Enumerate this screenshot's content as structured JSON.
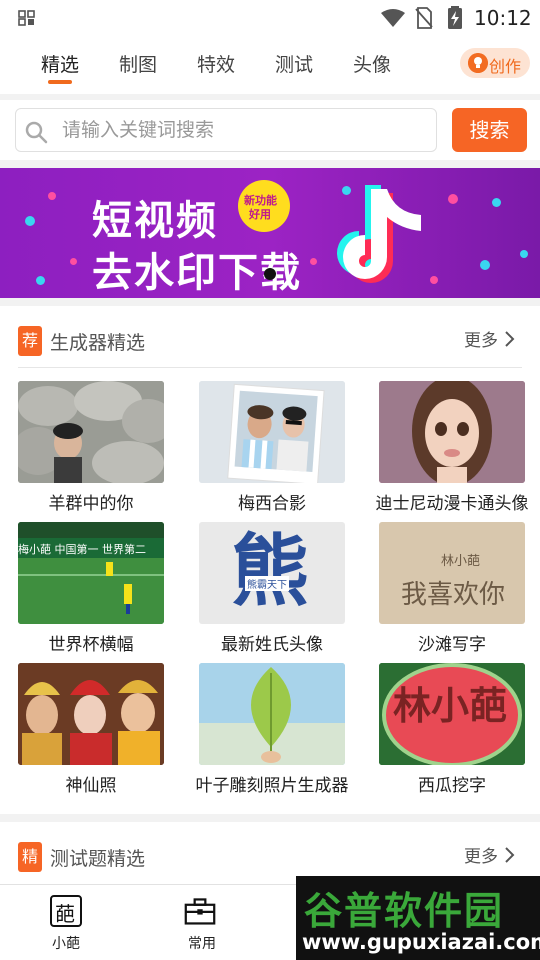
{
  "status_bar": {
    "time": "10:12"
  },
  "top_tabs": [
    "精选",
    "制图",
    "特效",
    "测试",
    "头像"
  ],
  "create_button": {
    "label": "创作"
  },
  "search": {
    "placeholder": "请输入关键词搜索",
    "button": "搜索"
  },
  "banner": {
    "line1": "短视频",
    "line2": "去水印下载",
    "badge_line1": "新功能",
    "badge_line2": "好用"
  },
  "generator_section": {
    "badge": "荐",
    "title": "生成器精选",
    "more": "更多",
    "items": [
      {
        "caption": "羊群中的你"
      },
      {
        "caption": "梅西合影"
      },
      {
        "caption": "迪士尼动漫卡通头像"
      },
      {
        "caption": "世界杯横幅",
        "thumb_text": "梅小葩 中国第一 世界第二"
      },
      {
        "caption": "最新姓氏头像",
        "thumb_text": "熊",
        "thumb_sub": "熊霸天下"
      },
      {
        "caption": "沙滩写字",
        "thumb_text1": "林小葩",
        "thumb_text2": "我喜欢你"
      },
      {
        "caption": "神仙照"
      },
      {
        "caption": "叶子雕刻照片生成器"
      },
      {
        "caption": "西瓜挖字",
        "thumb_text": "林小葩"
      }
    ]
  },
  "quiz_section": {
    "badge": "精",
    "title": "测试题精选",
    "more": "更多"
  },
  "bottom_nav": [
    {
      "label": "小葩",
      "icon_char": "葩"
    },
    {
      "label": "常用"
    }
  ],
  "watermark": {
    "line1": "谷普软件园",
    "line2": "www.gupuxiazai.com"
  },
  "colors": {
    "accent": "#f66525",
    "banner_purple": "#9c23c4"
  }
}
